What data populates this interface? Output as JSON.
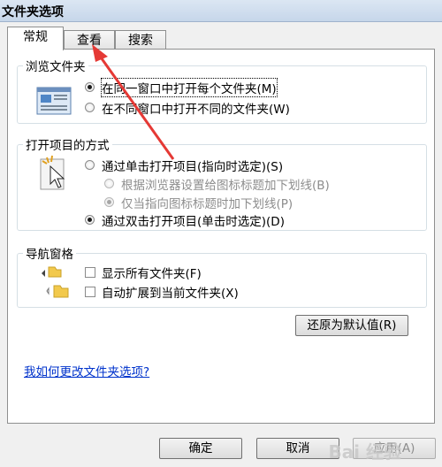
{
  "window": {
    "title": "文件夹选项"
  },
  "tabs": [
    {
      "label": "常规"
    },
    {
      "label": "查看"
    },
    {
      "label": "搜索"
    }
  ],
  "browse_group": {
    "title": "浏览文件夹",
    "options": [
      {
        "label": "在同一窗口中打开每个文件夹(M)",
        "selected": true
      },
      {
        "label": "在不同窗口中打开不同的文件夹(W)",
        "selected": false
      }
    ]
  },
  "click_group": {
    "title": "打开项目的方式",
    "options": [
      {
        "label": "通过单击打开项目(指向时选定)(S)",
        "selected": false
      },
      {
        "label": "根据浏览器设置给图标标题加下划线(B)",
        "selected": false,
        "disabled": true
      },
      {
        "label": "仅当指向图标标题时加下划线(P)",
        "selected": true,
        "disabled": true
      },
      {
        "label": "通过双击打开项目(单击时选定)(D)",
        "selected": true
      }
    ]
  },
  "nav_group": {
    "title": "导航窗格",
    "options": [
      {
        "label": "显示所有文件夹(F)",
        "checked": false
      },
      {
        "label": "自动扩展到当前文件夹(X)",
        "checked": false
      }
    ]
  },
  "restore_button": "还原为默认值(R)",
  "help_link": "我如何更改文件夹选项?",
  "footer": {
    "ok": "确定",
    "cancel": "取消",
    "apply": "应用(A)"
  },
  "watermark": "Bai 经验",
  "colors": {
    "arrow": "#e53935",
    "link": "#0033cc"
  }
}
